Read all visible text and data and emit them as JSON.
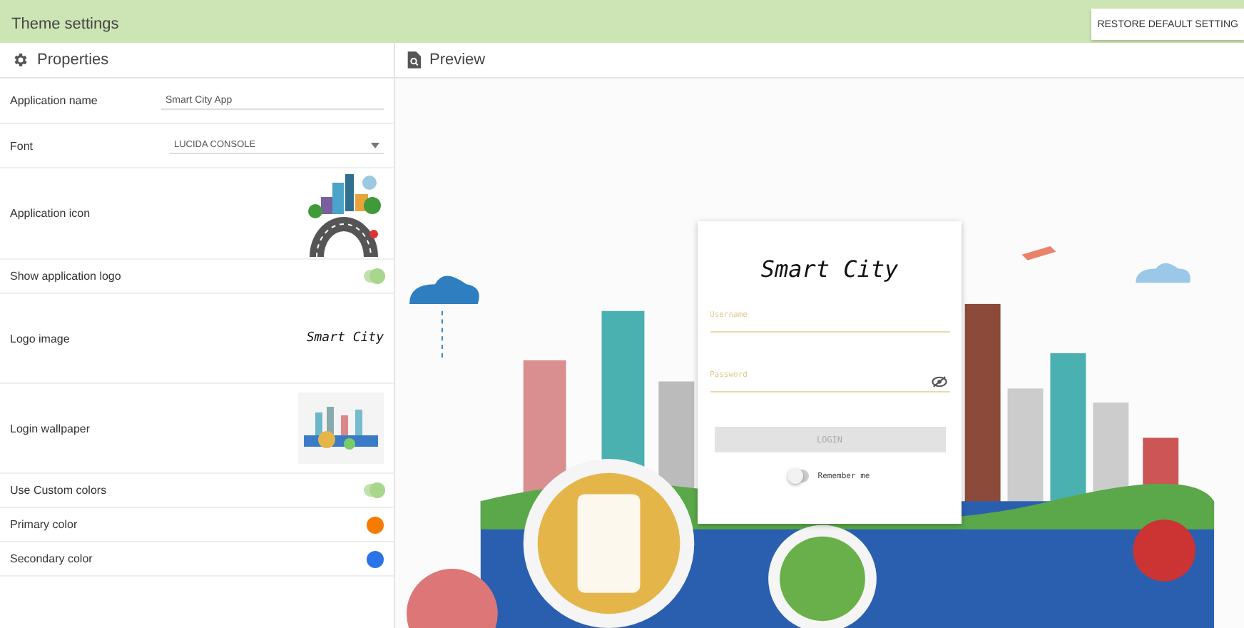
{
  "window": {
    "title": "Theme settings"
  },
  "restore_button": {
    "label": "RESTORE DEFAULT SETTING"
  },
  "properties": {
    "title": "Properties",
    "rows": [
      {
        "kind": "text",
        "label": "Application name",
        "value": "Smart City App"
      },
      {
        "kind": "select",
        "label": "Font",
        "value": "LUCIDA CONSOLE"
      },
      {
        "kind": "icon",
        "label": "Application icon"
      },
      {
        "kind": "toggle",
        "label": "Show application logo",
        "on": true
      },
      {
        "kind": "logo",
        "label": "Logo image",
        "value": "Smart City"
      },
      {
        "kind": "wallpaper",
        "label": "Login wallpaper"
      },
      {
        "kind": "toggle",
        "label": "Use Custom colors",
        "on": true
      },
      {
        "kind": "color",
        "label": "Primary color",
        "color": "#f57c00"
      },
      {
        "kind": "color",
        "label": "Secondary color",
        "color": "#2a73e8"
      }
    ]
  },
  "preview": {
    "title": "Preview",
    "login": {
      "title": "Smart City",
      "username_placeholder": "Username",
      "password_placeholder": "Password",
      "button": {
        "label": "LOGIN",
        "disabled": true
      },
      "remember": {
        "label": "Remember me",
        "on": false
      }
    }
  }
}
